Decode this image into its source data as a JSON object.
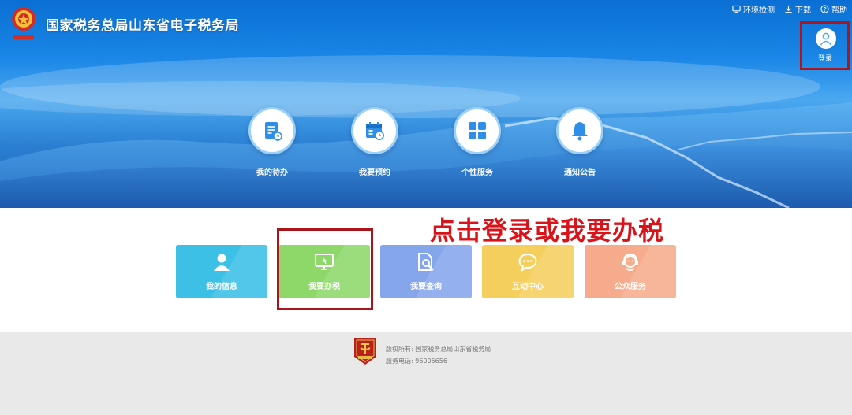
{
  "header": {
    "site_title": "国家税务总局山东省电子税务局",
    "links": [
      {
        "label": "环境检测",
        "icon": "monitor-check-icon"
      },
      {
        "label": "下载",
        "icon": "download-icon"
      },
      {
        "label": "帮助",
        "icon": "help-icon"
      }
    ],
    "login_label": "登录"
  },
  "quick_nav": [
    {
      "label": "我的待办",
      "icon": "todo-icon"
    },
    {
      "label": "我要预约",
      "icon": "calendar-clock-icon"
    },
    {
      "label": "个性服务",
      "icon": "grid-icon"
    },
    {
      "label": "通知公告",
      "icon": "bell-icon"
    }
  ],
  "annotation": "点击登录或我要办税",
  "tiles": [
    {
      "label": "我的信息",
      "icon": "user-icon",
      "color": "#3cc0e6"
    },
    {
      "label": "我要办税",
      "icon": "computer-icon",
      "color": "#8ed86a"
    },
    {
      "label": "我要查询",
      "icon": "search-doc-icon",
      "color": "#86a6ec"
    },
    {
      "label": "互动中心",
      "icon": "chat-icon",
      "color": "#f5cf5e"
    },
    {
      "label": "公众服务",
      "icon": "service-icon",
      "color": "#f6ac8c"
    }
  ],
  "footer": {
    "copyright": "版权所有: 国家税务总局山东省税务局",
    "phone": "服务电话: 96005656"
  },
  "colors": {
    "banner_blue": "#1a86e6",
    "highlight_red": "#b0151a",
    "annotation_red": "#d9131a",
    "footer_bg": "#e9e9e9"
  }
}
